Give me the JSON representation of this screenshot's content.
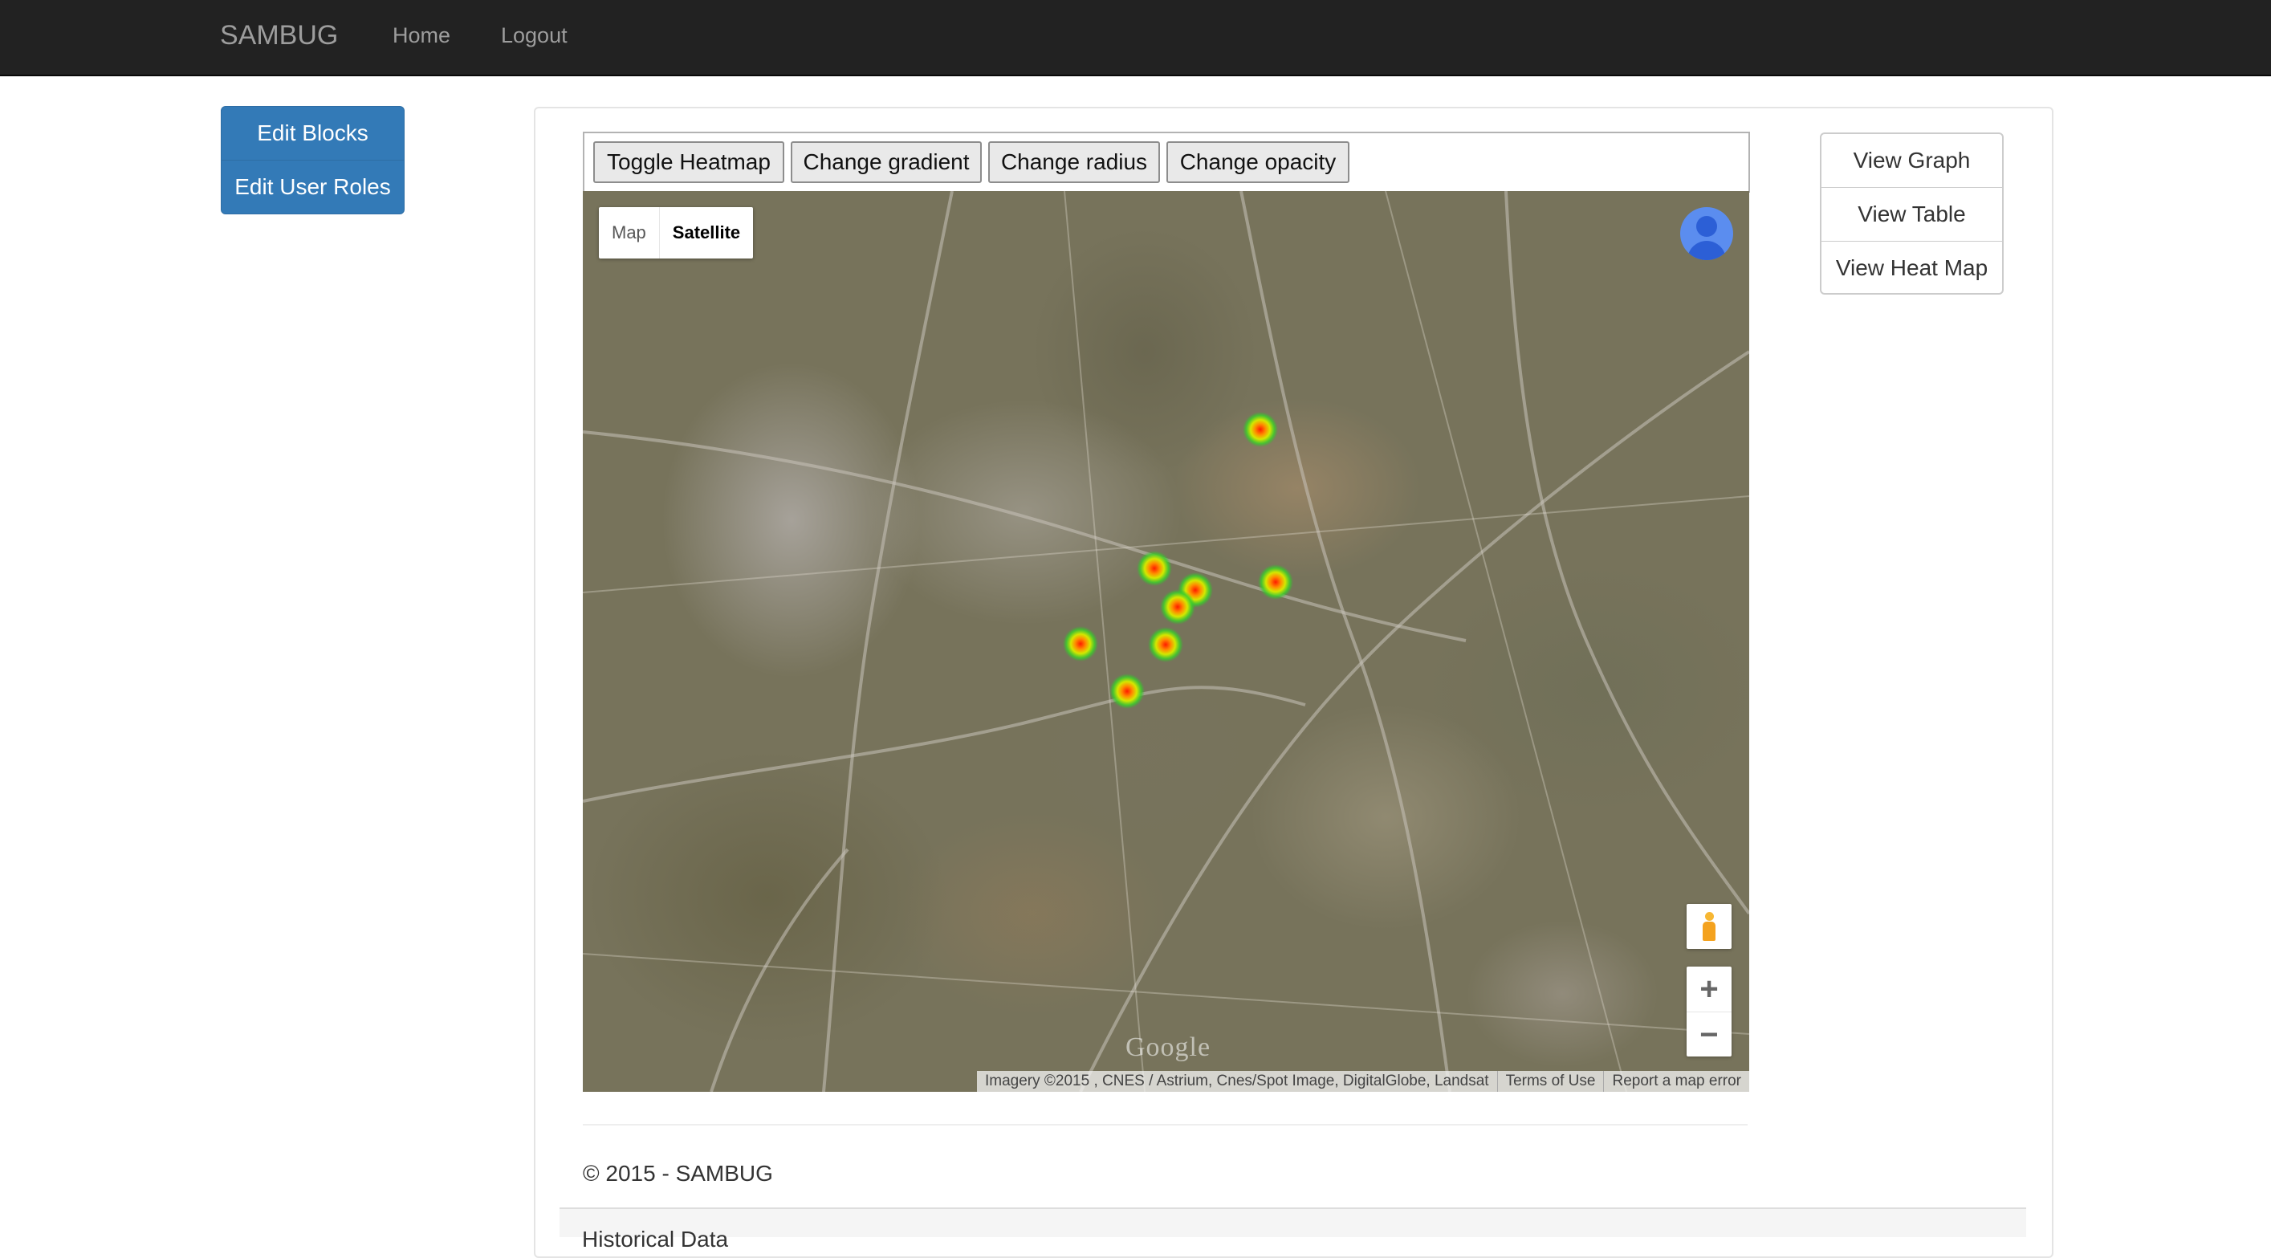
{
  "navbar": {
    "brand": "SAMBUG",
    "links": [
      "Home",
      "Logout"
    ]
  },
  "admin": {
    "buttons": [
      "Edit Blocks",
      "Edit User Roles"
    ],
    "color": "#337ab7"
  },
  "toolbar": {
    "buttons": [
      "Toggle Heatmap",
      "Change gradient",
      "Change radius",
      "Change opacity"
    ]
  },
  "map": {
    "type_options": [
      "Map",
      "Satellite"
    ],
    "selected_type": "Satellite",
    "zoom_in": "+",
    "zoom_out": "−",
    "logo": "Google",
    "attribution": [
      "Imagery ©2015 , CNES / Astrium, Cnes/Spot Image, DigitalGlobe, Landsat",
      "Terms of Use",
      "Report a map error"
    ],
    "icons": [
      "user-profile-icon",
      "pegman-icon"
    ]
  },
  "view_menu": {
    "buttons": [
      "View Graph",
      "View Table",
      "View Heat Map"
    ]
  },
  "footer": {
    "copyright": "© 2015 - SAMBUG",
    "next_section": "Historical Data"
  }
}
